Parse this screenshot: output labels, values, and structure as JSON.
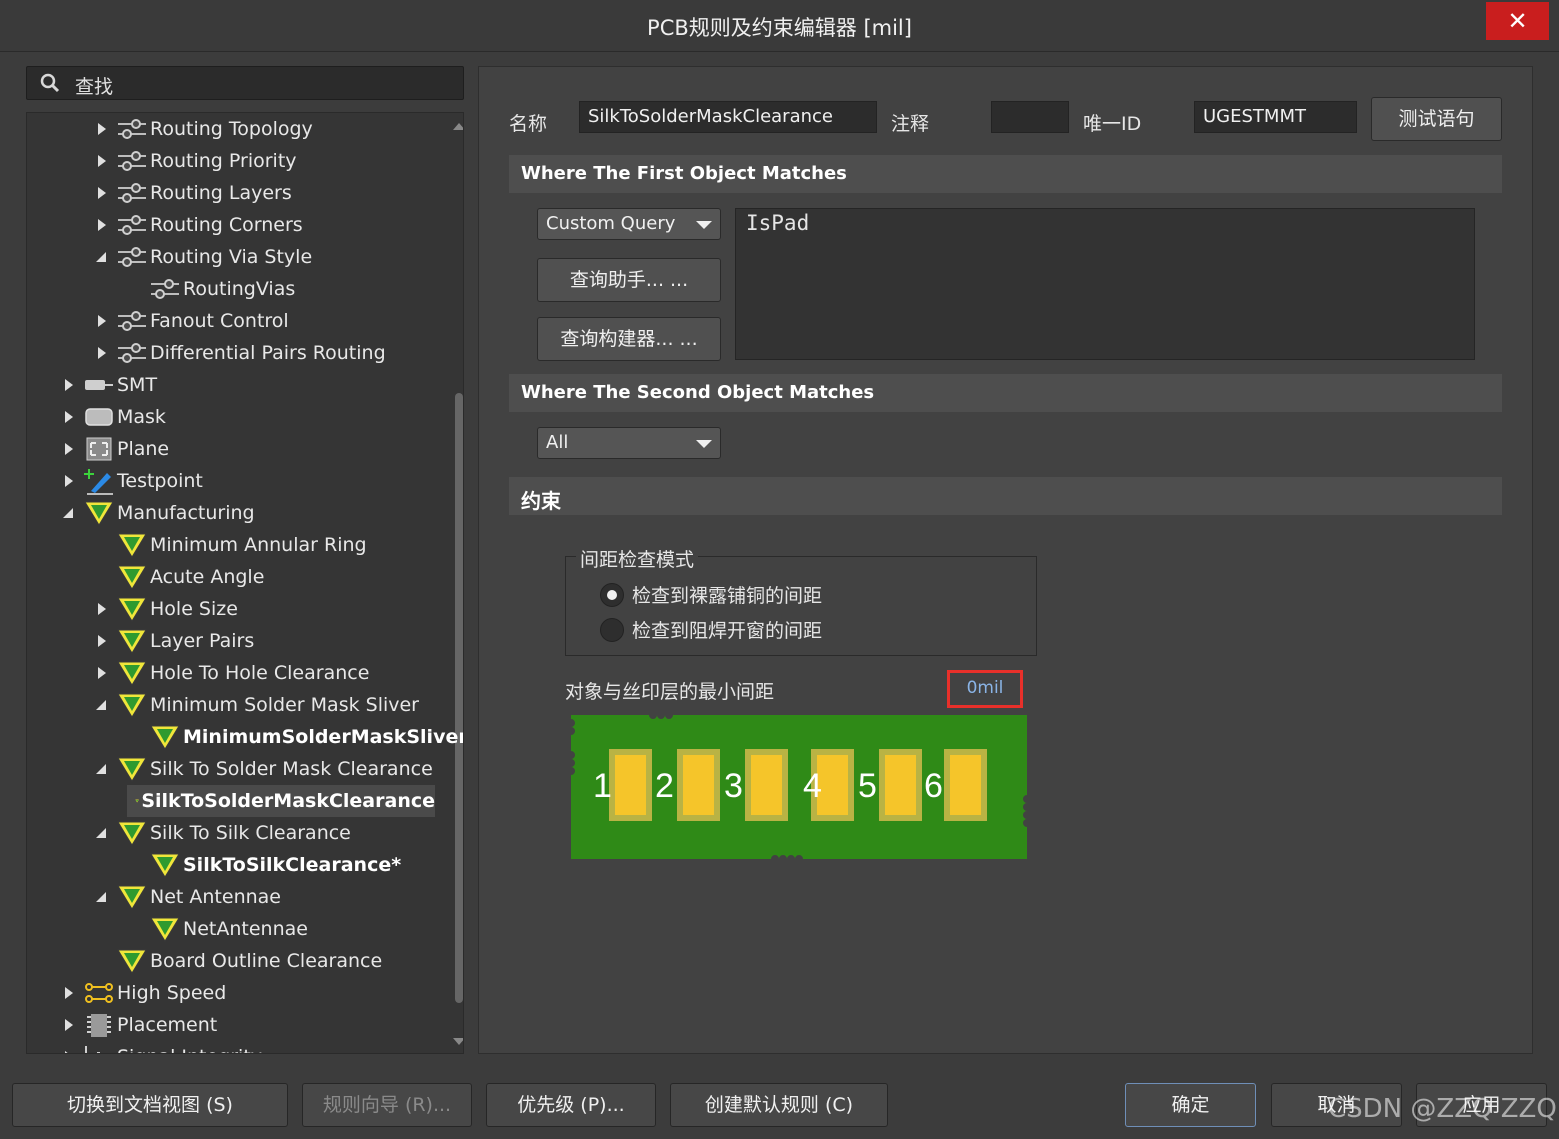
{
  "window": {
    "title": "PCB规则及约束编辑器 [mil]",
    "close_glyph": "✕"
  },
  "search": {
    "label": "查找"
  },
  "tree": {
    "items": [
      {
        "label": "Routing Topology",
        "expand": "right",
        "icon": "routing-icon"
      },
      {
        "label": "Routing Priority",
        "expand": "right",
        "icon": "routing-icon"
      },
      {
        "label": "Routing Layers",
        "expand": "right",
        "icon": "routing-icon"
      },
      {
        "label": "Routing Corners",
        "expand": "right",
        "icon": "routing-icon"
      },
      {
        "label": "Routing Via Style",
        "expand": "down",
        "icon": "routing-icon"
      },
      {
        "label": "RoutingVias",
        "expand": "none",
        "icon": "routing-icon"
      },
      {
        "label": "Fanout Control",
        "expand": "right",
        "icon": "routing-icon"
      },
      {
        "label": "Differential Pairs Routing",
        "expand": "right",
        "icon": "routing-icon"
      },
      {
        "label": "SMT",
        "expand": "right",
        "icon": "smt-icon"
      },
      {
        "label": "Mask",
        "expand": "right",
        "icon": "mask-icon"
      },
      {
        "label": "Plane",
        "expand": "right",
        "icon": "plane-icon"
      },
      {
        "label": "Testpoint",
        "expand": "right",
        "icon": "testpoint-icon"
      },
      {
        "label": "Manufacturing",
        "expand": "down",
        "icon": "manufacturing-icon"
      },
      {
        "label": "Minimum Annular Ring",
        "expand": "none",
        "icon": "manufacturing-icon"
      },
      {
        "label": "Acute Angle",
        "expand": "none",
        "icon": "manufacturing-icon"
      },
      {
        "label": "Hole Size",
        "expand": "right",
        "icon": "manufacturing-icon"
      },
      {
        "label": "Layer Pairs",
        "expand": "right",
        "icon": "manufacturing-icon"
      },
      {
        "label": "Hole To Hole Clearance",
        "expand": "right",
        "icon": "manufacturing-icon"
      },
      {
        "label": "Minimum Solder Mask Sliver",
        "expand": "down",
        "icon": "manufacturing-icon"
      },
      {
        "label": "MinimumSolderMaskSliver",
        "expand": "none",
        "icon": "manufacturing-icon",
        "bold": true
      },
      {
        "label": "Silk To Solder Mask Clearance",
        "expand": "down",
        "icon": "manufacturing-icon"
      },
      {
        "label": "SilkToSolderMaskClearance",
        "expand": "none",
        "icon": "manufacturing-icon",
        "bold": true,
        "selected": true
      },
      {
        "label": "Silk To Silk Clearance",
        "expand": "down",
        "icon": "manufacturing-icon"
      },
      {
        "label": "SilkToSilkClearance*",
        "expand": "none",
        "icon": "manufacturing-icon",
        "bold": true
      },
      {
        "label": "Net Antennae",
        "expand": "down",
        "icon": "manufacturing-icon"
      },
      {
        "label": "NetAntennae",
        "expand": "none",
        "icon": "manufacturing-icon"
      },
      {
        "label": "Board Outline Clearance",
        "expand": "none",
        "icon": "manufacturing-icon"
      },
      {
        "label": "High Speed",
        "expand": "right",
        "icon": "highspeed-icon"
      },
      {
        "label": "Placement",
        "expand": "right",
        "icon": "placement-icon"
      },
      {
        "label": "Signal Integrity",
        "expand": "right",
        "icon": "signal-icon"
      }
    ]
  },
  "header": {
    "name_label": "名称",
    "name_value": "SilkToSolderMaskClearance",
    "comment_label": "注释",
    "comment_value": "",
    "uid_label": "唯一ID",
    "uid_value": "UGESTMMT",
    "test_button": "测试语句"
  },
  "first_match": {
    "title": "Where The First Object Matches",
    "dropdown_value": "Custom Query",
    "helper_button": "查询助手... ...",
    "builder_button": "查询构建器... ...",
    "query": "IsPad"
  },
  "second_match": {
    "title": "Where The Second Object Matches",
    "dropdown_value": "All"
  },
  "constraints": {
    "title": "约束",
    "mode_group_title": "间距检查模式",
    "option_1": "检查到裸露铺铜的间距",
    "option_2": "检查到阻焊开窗的间距",
    "selected_option": 1,
    "min_clearance_label": "对象与丝印层的最小间距",
    "min_clearance_value": "0mil",
    "pad_numbers": [
      "1",
      "2",
      "3",
      "4",
      "5",
      "6"
    ]
  },
  "footer": {
    "switch_doc_view": "切换到文档视图 (S)",
    "rule_wizard": "规则向导 (R)...",
    "priority": "优先级 (P)...",
    "create_default": "创建默认规则 (C)",
    "ok": "确定",
    "cancel": "取消",
    "apply": "应用"
  },
  "watermark": "CSDN @ZZQ ZZQ",
  "colors": {
    "background": "#3c3c3c",
    "close_red": "#c91e1e",
    "highlight_red": "#e8302a",
    "pcb_green": "#2f8a17",
    "pad_yellow": "#f5c52a",
    "pad_outline": "#c4b23a"
  }
}
